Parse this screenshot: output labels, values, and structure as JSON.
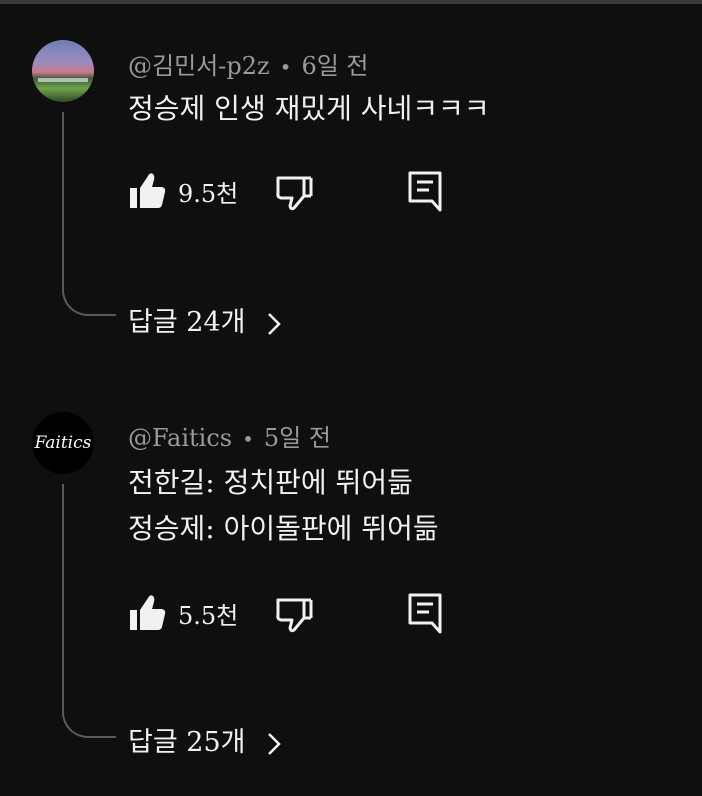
{
  "comments": [
    {
      "author": "@김민서-p2z",
      "separator": "•",
      "time": "6일 전",
      "lines": [
        "정승제 인생 재밌게 사네ㅋㅋㅋ"
      ],
      "likes": "9.5천",
      "replies": "답글 24개",
      "avatar_icon": "stadium-photo-avatar"
    },
    {
      "author": "@Faitics",
      "separator": "•",
      "time": "5일 전",
      "lines": [
        "전한길: 정치판에 뛰어듦",
        "정승제: 아이돌판에 뛰어듦"
      ],
      "likes": "5.5천",
      "replies": "답글 25개",
      "avatar_text": "Faitics"
    }
  ],
  "icons": {
    "like": "thumbs-up-icon",
    "dislike": "thumbs-down-icon",
    "reply": "comment-icon",
    "chevron": "chevron-right-icon"
  },
  "colors": {
    "background": "#0f0f0f",
    "text": "#f1f1f1",
    "meta": "#9a9a9a",
    "thread": "#5a5a5a"
  }
}
